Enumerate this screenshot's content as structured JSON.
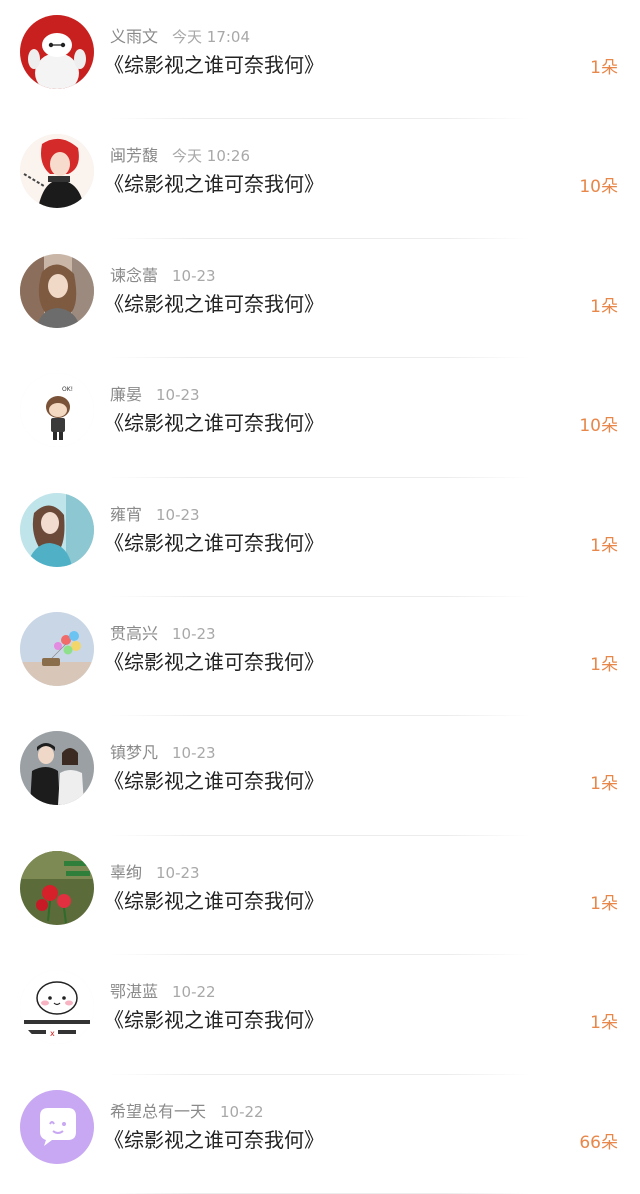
{
  "items": [
    {
      "name": "义雨文",
      "time": "今天 17:04",
      "title": "《综影视之谁可奈我何》",
      "count": "1朵",
      "avatar": "baymax-avatar"
    },
    {
      "name": "闽芳馥",
      "time": "今天 10:26",
      "title": "《综影视之谁可奈我何》",
      "count": "10朵",
      "avatar": "red-hair-anime-avatar"
    },
    {
      "name": "谏念蕾",
      "time": "10-23",
      "title": "《综影视之谁可奈我何》",
      "count": "1朵",
      "avatar": "girl-photo-avatar"
    },
    {
      "name": "廉晏",
      "time": "10-23",
      "title": "《综影视之谁可奈我何》",
      "count": "10朵",
      "avatar": "cartoon-boy-avatar"
    },
    {
      "name": "雍宵",
      "time": "10-23",
      "title": "《综影视之谁可奈我何》",
      "count": "1朵",
      "avatar": "girl-blue-avatar"
    },
    {
      "name": "贯高兴",
      "time": "10-23",
      "title": "《综影视之谁可奈我何》",
      "count": "1朵",
      "avatar": "balloons-avatar"
    },
    {
      "name": "镇梦凡",
      "time": "10-23",
      "title": "《综影视之谁可奈我何》",
      "count": "1朵",
      "avatar": "couple-photo-avatar"
    },
    {
      "name": "辜绚",
      "time": "10-23",
      "title": "《综影视之谁可奈我何》",
      "count": "1朵",
      "avatar": "roses-avatar"
    },
    {
      "name": "鄂湛蓝",
      "time": "10-22",
      "title": "《综影视之谁可奈我何》",
      "count": "1朵",
      "avatar": "cute-bun-meme-avatar"
    },
    {
      "name": "希望总有一天",
      "time": "10-22",
      "title": "《综影视之谁可奈我何》",
      "count": "66朵",
      "avatar": "chat-bubble-avatar"
    }
  ],
  "colors": {
    "count": "#e8874a",
    "name": "#8a8a8a",
    "title": "#222222"
  }
}
